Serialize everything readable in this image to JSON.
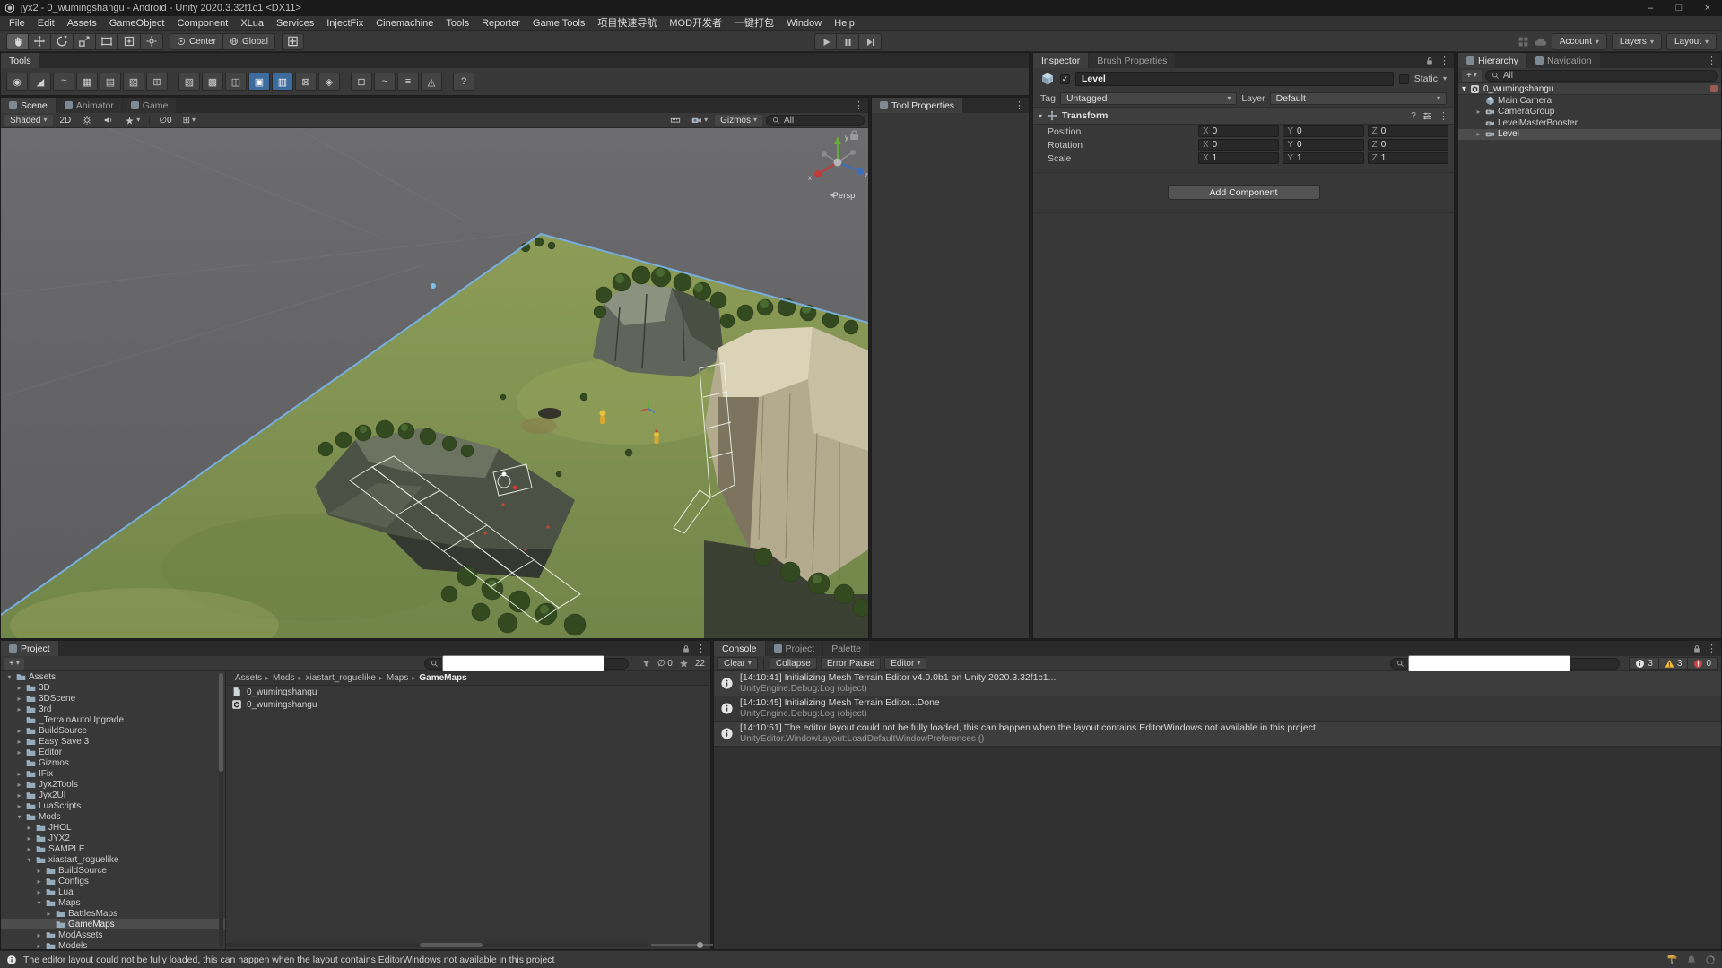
{
  "icons": {
    "caret_down": "▾",
    "menu_dots": "⋮",
    "plus": "+",
    "check": "✓",
    "help": "?",
    "grid": "⊞",
    "projection_arrow": "◄"
  },
  "window": {
    "title": "jyx2 - 0_wumingshangu - Android - Unity 2020.3.32f1c1  <DX11>",
    "minimize": "–",
    "maximize": "□",
    "close": "×"
  },
  "menubar": {
    "items": [
      "File",
      "Edit",
      "Assets",
      "GameObject",
      "Component",
      "XLua",
      "Services",
      "InjectFix",
      "Cinemachine",
      "Tools",
      "Reporter",
      "Game Tools",
      "项目快速导航",
      "MOD开发者",
      "一键打包",
      "Window",
      "Help"
    ]
  },
  "toolbar": {
    "pivot": "Center",
    "space": "Global",
    "account": "Account",
    "layers": "Layers",
    "layout": "Layout"
  },
  "tools_panel": {
    "tab": "Tools",
    "buttons": [
      {
        "glyph": "◉"
      },
      {
        "glyph": "◢"
      },
      {
        "glyph": "≈"
      },
      {
        "glyph": "▦"
      },
      {
        "glyph": "▤"
      },
      {
        "glyph": "▧"
      },
      {
        "glyph": "⊞"
      },
      {
        "glyph": "▨",
        "gap": true
      },
      {
        "glyph": "▩"
      },
      {
        "glyph": "◫"
      },
      {
        "glyph": "▣",
        "active": true
      },
      {
        "glyph": "▥",
        "active": true
      },
      {
        "glyph": "⊠"
      },
      {
        "glyph": "◈"
      },
      {
        "glyph": "⊟",
        "gap": true
      },
      {
        "glyph": "~"
      },
      {
        "glyph": "≡"
      },
      {
        "glyph": "◬"
      },
      {
        "glyph": "?",
        "gap": true
      }
    ]
  },
  "scene": {
    "tabs": [
      {
        "label": "Scene",
        "active": true,
        "icon": true
      },
      {
        "label": "Animator",
        "active": false,
        "icon": true
      },
      {
        "label": "Game",
        "active": false,
        "icon": true
      }
    ],
    "shading": "Shaded",
    "toggle_2d": "2D",
    "hidden_count": "∅0",
    "gizmos": "Gizmos",
    "search_value": "All",
    "projection": "Persp",
    "axes": {
      "x": "x",
      "y": "y",
      "z": "z"
    }
  },
  "tool_properties": {
    "tabs": [
      {
        "label": "Tool Properties",
        "active": true,
        "icon": true
      }
    ]
  },
  "inspector": {
    "tabs": [
      {
        "label": "Inspector",
        "active": true,
        "icon": false
      },
      {
        "label": "Brush Properties",
        "active": false,
        "icon": false
      }
    ],
    "name": "Level",
    "static_label": "Static",
    "tag_label": "Tag",
    "tag": "Untagged",
    "layer_label": "Layer",
    "layer": "Default",
    "component": "Transform",
    "rows": [
      {
        "label": "Position",
        "xl": "X",
        "x": "0",
        "yl": "Y",
        "y": "0",
        "zl": "Z",
        "z": "0"
      },
      {
        "label": "Rotation",
        "xl": "X",
        "x": "0",
        "yl": "Y",
        "y": "0",
        "zl": "Z",
        "z": "0"
      },
      {
        "label": "Scale",
        "xl": "X",
        "x": "1",
        "yl": "Y",
        "y": "1",
        "zl": "Z",
        "z": "1"
      }
    ],
    "add_component": "Add Component"
  },
  "hierarchy": {
    "tabs": [
      {
        "label": "Hierarchy",
        "active": true,
        "icon": true
      },
      {
        "label": "Navigation",
        "active": false,
        "icon": true
      }
    ],
    "search_value": "All",
    "scene_row": "0_wumingshangu",
    "items": [
      {
        "label": "Main Camera",
        "arrow": "",
        "is_camera": true,
        "is_cube": false,
        "selected": false,
        "depth": 1
      },
      {
        "label": "CameraGroup",
        "arrow": "▸",
        "is_camera": false,
        "is_cube": true,
        "selected": false,
        "depth": 1
      },
      {
        "label": "LevelMasterBooster",
        "arrow": "",
        "is_camera": false,
        "is_cube": true,
        "selected": false,
        "depth": 1
      },
      {
        "label": "Level",
        "arrow": "▸",
        "is_camera": false,
        "is_cube": true,
        "selected": true,
        "depth": 1
      }
    ]
  },
  "project": {
    "tabs": [
      {
        "label": "Project",
        "active": true,
        "icon": true
      }
    ],
    "hidden_count": "∅ 0",
    "zoom_count": "22",
    "tree": [
      {
        "label": "Assets",
        "arrow": "▾",
        "depth": 0
      },
      {
        "label": "3D",
        "arrow": "▸",
        "depth": 1
      },
      {
        "label": "3DScene",
        "arrow": "▸",
        "depth": 1
      },
      {
        "label": "3rd",
        "arrow": "▸",
        "depth": 1
      },
      {
        "label": "_TerrainAutoUpgrade",
        "arrow": "",
        "depth": 1
      },
      {
        "label": "BuildSource",
        "arrow": "▸",
        "depth": 1
      },
      {
        "label": "Easy Save 3",
        "arrow": "▸",
        "depth": 1
      },
      {
        "label": "Editor",
        "arrow": "▸",
        "depth": 1
      },
      {
        "label": "Gizmos",
        "arrow": "",
        "depth": 1
      },
      {
        "label": "IFix",
        "arrow": "▸",
        "depth": 1
      },
      {
        "label": "Jyx2Tools",
        "arrow": "▸",
        "depth": 1
      },
      {
        "label": "Jyx2UI",
        "arrow": "▸",
        "depth": 1
      },
      {
        "label": "LuaScripts",
        "arrow": "▸",
        "depth": 1
      },
      {
        "label": "Mods",
        "arrow": "▾",
        "depth": 1
      },
      {
        "label": "JHOL",
        "arrow": "▸",
        "depth": 2
      },
      {
        "label": "JYX2",
        "arrow": "▸",
        "depth": 2
      },
      {
        "label": "SAMPLE",
        "arrow": "▸",
        "depth": 2
      },
      {
        "label": "xiastart_roguelike",
        "arrow": "▾",
        "depth": 2
      },
      {
        "label": "BuildSource",
        "arrow": "▸",
        "depth": 3
      },
      {
        "label": "Configs",
        "arrow": "▸",
        "depth": 3
      },
      {
        "label": "Lua",
        "arrow": "▸",
        "depth": 3
      },
      {
        "label": "Maps",
        "arrow": "▾",
        "depth": 3
      },
      {
        "label": "BattlesMaps",
        "arrow": "▸",
        "depth": 4
      },
      {
        "label": "GameMaps",
        "arrow": "",
        "depth": 4,
        "selected": true
      },
      {
        "label": "ModAssets",
        "arrow": "▸",
        "depth": 3
      },
      {
        "label": "Models",
        "arrow": "▸",
        "depth": 3
      }
    ],
    "breadcrumb": [
      {
        "label": "Assets",
        "sep": ""
      },
      {
        "label": "Mods",
        "sep": "▸"
      },
      {
        "label": "xiastart_roguelike",
        "sep": "▸"
      },
      {
        "label": "Maps",
        "sep": "▸"
      },
      {
        "label": "GameMaps",
        "sep": "▸",
        "current": true
      }
    ],
    "files": [
      {
        "name": "0_wumingshangu",
        "is_scene": true,
        "is_doc": false
      },
      {
        "name": "0_wumingshangu",
        "is_scene": false,
        "is_doc": true
      }
    ]
  },
  "console": {
    "tabs": [
      {
        "label": "Console",
        "active": true,
        "icon": false
      },
      {
        "label": "Project",
        "active": false,
        "icon": true
      },
      {
        "label": "Palette",
        "active": false,
        "icon": false
      }
    ],
    "clear_label": "Clear",
    "collapse_label": "Collapse",
    "error_pause_label": "Error Pause",
    "editor_label": "Editor",
    "info_count": "3",
    "warn_count": "3",
    "error_count": "0",
    "entries": [
      {
        "message": "[14:10:41] Initializing Mesh Terrain Editor v4.0.0b1 on Unity 2020.3.32f1c1...",
        "stack": "UnityEngine.Debug:Log (object)"
      },
      {
        "message": "[14:10:45] Initializing Mesh Terrain Editor...Done",
        "stack": "UnityEngine.Debug:Log (object)"
      },
      {
        "message": "[14:10:51] The editor layout could not be fully loaded, this can happen when the layout contains EditorWindows not available in this project",
        "stack": "UnityEditor.WindowLayout:LoadDefaultWindowPreferences ()"
      }
    ]
  },
  "statusbar": {
    "message": "The editor layout could not be fully loaded, this can happen when the layout contains EditorWindows not available in this project"
  }
}
